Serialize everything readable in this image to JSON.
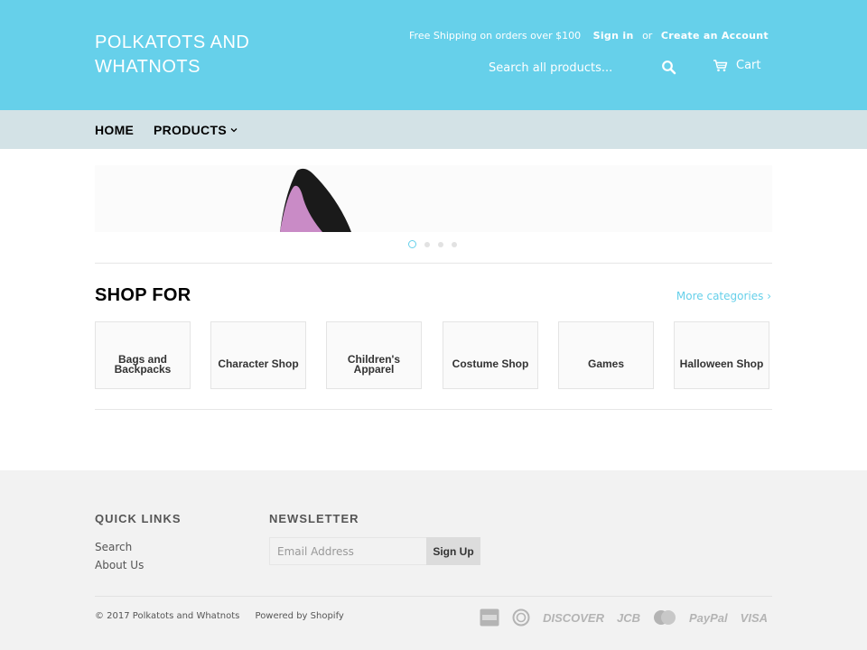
{
  "header": {
    "logo_line1": "POLKATOTS AND",
    "logo_line2": "WHATNOTS",
    "shipping_text": "Free Shipping on orders over $100",
    "sign_in": "Sign in",
    "or_text": "or",
    "create_account": "Create an Account",
    "search_placeholder": "Search all products...",
    "search_icon": "search-icon",
    "cart_label": "Cart",
    "cart_icon": "cart-icon",
    "background_color": "#66d0ea"
  },
  "nav": {
    "home": "HOME",
    "products": "PRODUCTS",
    "products_icon": "chevron-down-icon",
    "background_color": "#d3e2e6"
  },
  "slideshow": {
    "dots_count": 4,
    "active_dot": 1
  },
  "shop_for": {
    "title": "SHOP FOR",
    "more_link": "More categories ›",
    "categories": [
      "Bags and Backpacks",
      "Character Shop",
      "Children's Apparel",
      "Costume Shop",
      "Games",
      "Halloween Shop"
    ]
  },
  "footer": {
    "quick_links_title": "QUICK LINKS",
    "quick_links": [
      "Search",
      "About Us"
    ],
    "newsletter_title": "NEWSLETTER",
    "email_placeholder": "Email Address",
    "signup_label": "Sign Up",
    "copyright": "© 2017 Polkatots and Whatnots",
    "powered_by": "Powered by Shopify",
    "payment_icons": [
      "american-express-icon",
      "diners-club-icon",
      "discover-icon",
      "jcb-icon",
      "mastercard-icon",
      "paypal-icon",
      "visa-icon"
    ],
    "payment_labels": {
      "discover": "DISCOVER",
      "jcb": "JCB",
      "paypal": "PayPal",
      "visa": "VISA"
    },
    "accent_color": "#66d0ea"
  }
}
